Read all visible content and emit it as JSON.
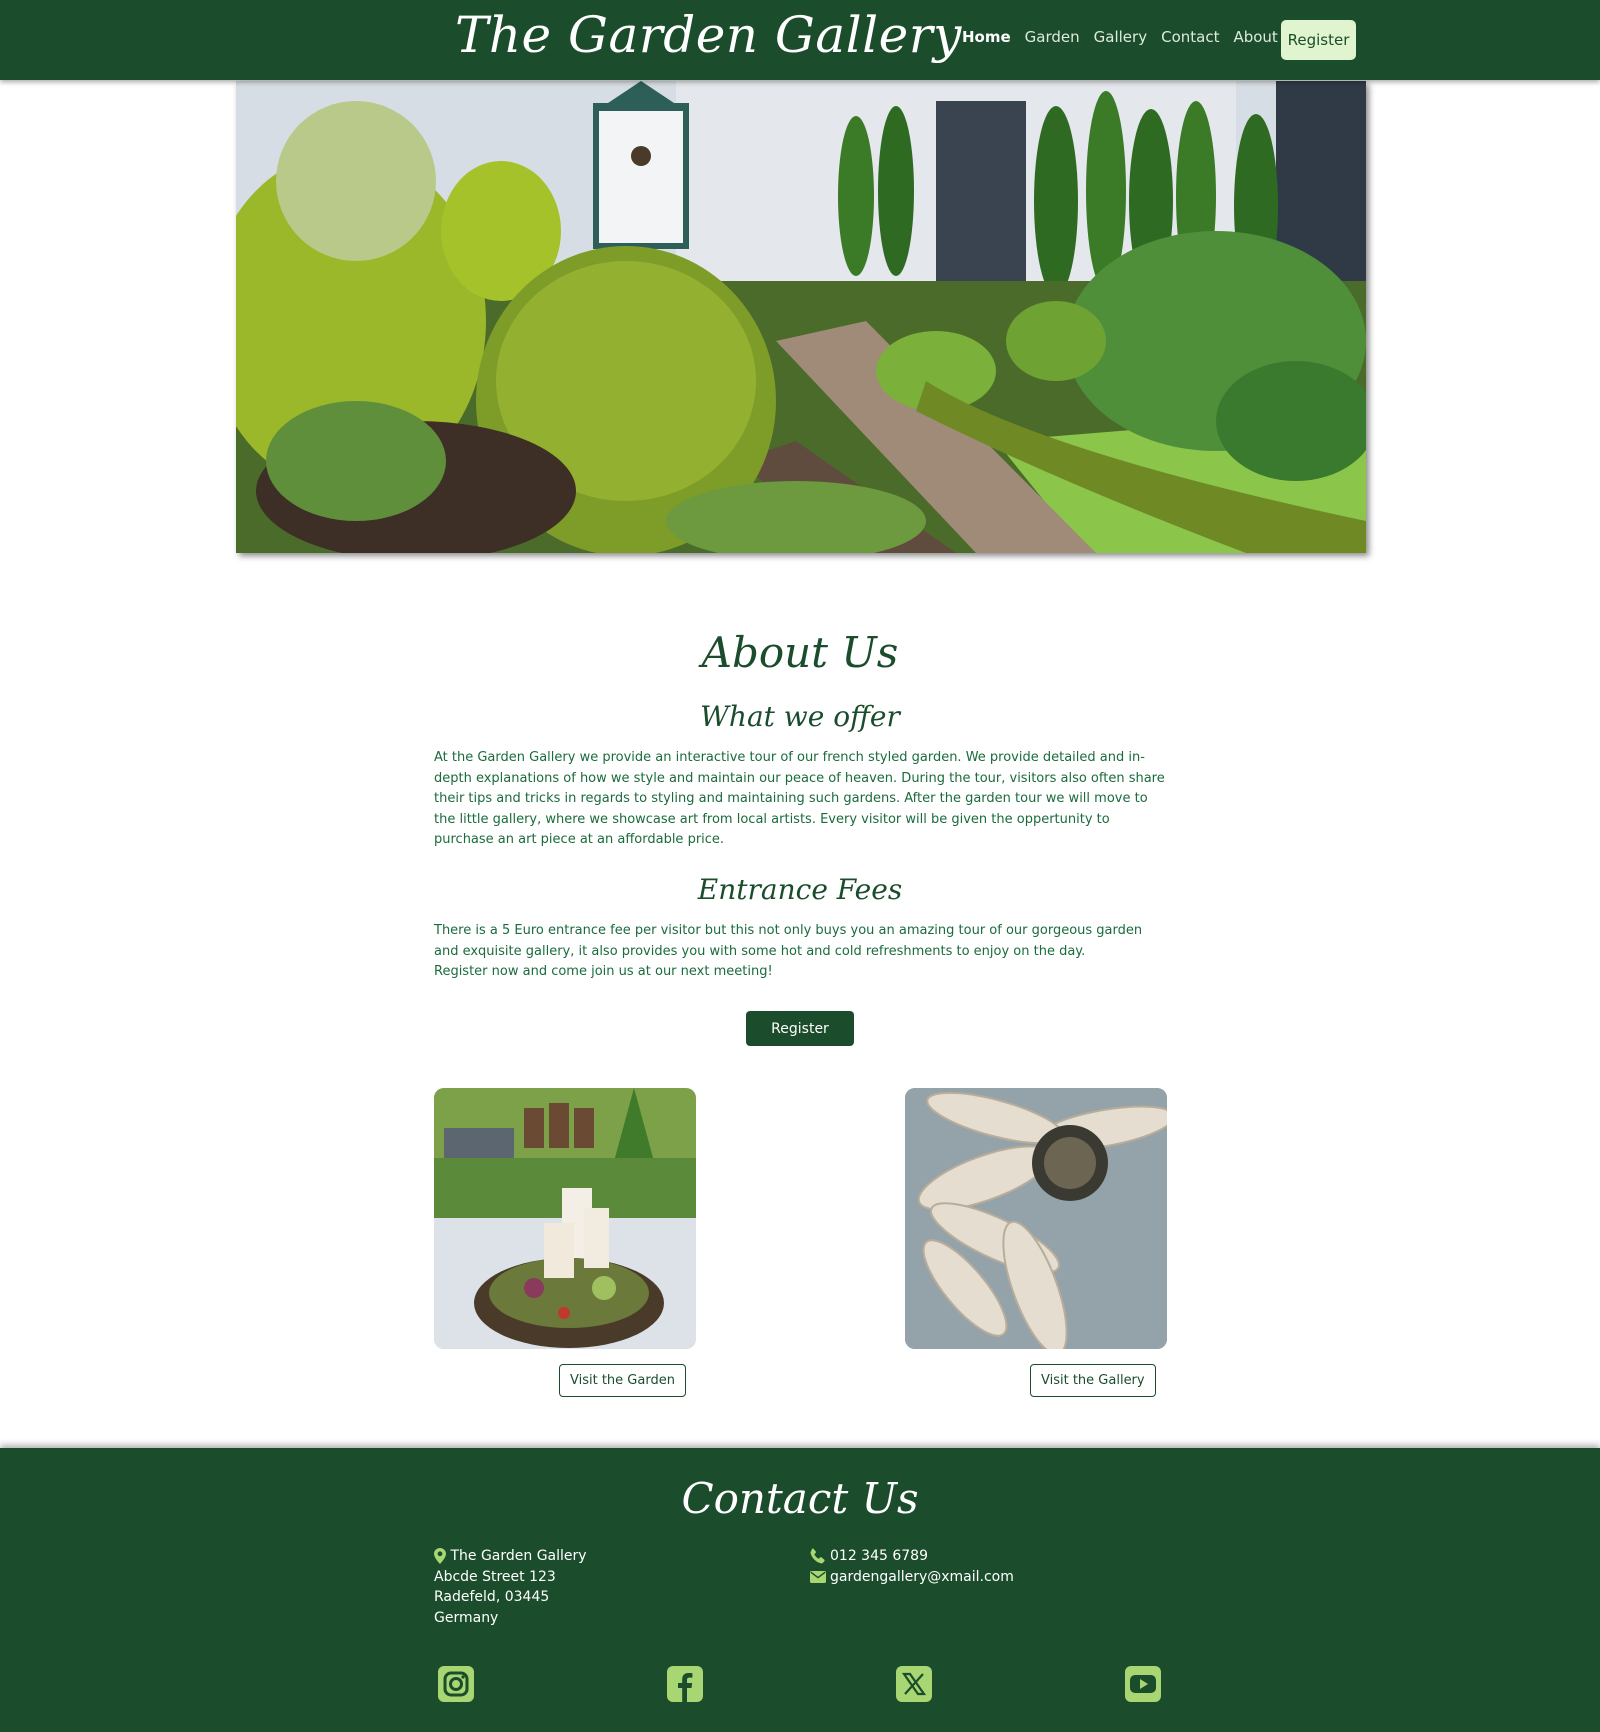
{
  "header": {
    "brand": "The Garden Gallery",
    "nav": [
      {
        "label": "Home",
        "active": true
      },
      {
        "label": "Garden",
        "active": false
      },
      {
        "label": "Gallery",
        "active": false
      },
      {
        "label": "Contact",
        "active": false
      },
      {
        "label": "About",
        "active": false
      }
    ],
    "register_label": "Register"
  },
  "about": {
    "title": "About Us",
    "offer_heading": "What we offer",
    "offer_text": "At the Garden Gallery we provide an interactive tour of our french styled garden. We provide detailed and in-depth explanations of how we style and maintain our peace of heaven. During the tour, visitors also often share their tips and tricks in regards to styling and maintaining such gardens. After the garden tour we will move to the little gallery, where we showcase art from local artists. Every visitor will be given the oppertunity to purchase an art piece at an affordable price.",
    "fees_heading": "Entrance Fees",
    "fees_text": "There is a 5 Euro entrance fee per visitor but this not only buys you an amazing tour of our gorgeous garden and exquisite gallery, it also provides you with some hot and cold refreshments to enjoy on the day.",
    "fees_text_2": "Register now and come join us at our next meeting!",
    "register_label": "Register"
  },
  "cards": [
    {
      "button": "Visit the Garden"
    },
    {
      "button": "Visit the Gallery"
    }
  ],
  "footer": {
    "title": "Contact Us",
    "address": [
      "The Garden Gallery",
      "Abcde Street 123",
      "Radefeld, 03445",
      "Germany"
    ],
    "phone": "012 345 6789",
    "email": "gardengallery@xmail.com",
    "social_icons": [
      "instagram-icon",
      "facebook-icon",
      "x-twitter-icon",
      "youtube-icon"
    ]
  },
  "colors": {
    "primary": "#1b4d2c",
    "accent": "#dff4cf",
    "icon": "#a8d672",
    "text": "#1b6b3c"
  }
}
